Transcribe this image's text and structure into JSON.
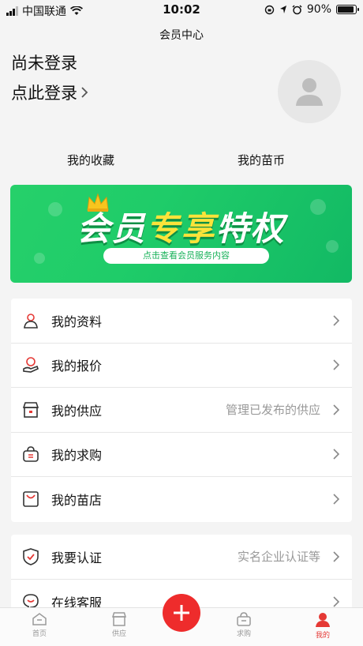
{
  "status_bar": {
    "carrier": "中国联通",
    "time": "10:02",
    "battery": "90%",
    "battery_level": 0.9
  },
  "nav": {
    "title": "会员中心"
  },
  "profile": {
    "name": "尚未登录",
    "login_prompt": "点此登录"
  },
  "quick_links": [
    {
      "label": "我的收藏"
    },
    {
      "label": "我的苗币"
    }
  ],
  "banner": {
    "title_part1": "会员",
    "title_highlight": "专享",
    "title_part2": "特权",
    "subtitle": "点击查看会员服务内容"
  },
  "menu_group1": [
    {
      "label": "我的资料",
      "hint": "",
      "icon": "profile-icon"
    },
    {
      "label": "我的报价",
      "hint": "",
      "icon": "quote-icon"
    },
    {
      "label": "我的供应",
      "hint": "管理已发布的供应",
      "icon": "store-icon"
    },
    {
      "label": "我的求购",
      "hint": "",
      "icon": "basket-icon"
    },
    {
      "label": "我的苗店",
      "hint": "",
      "icon": "shop-bag-icon"
    }
  ],
  "menu_group2": [
    {
      "label": "我要认证",
      "hint": "实名企业认证等",
      "icon": "shield-icon"
    },
    {
      "label": "在线客服",
      "hint": "",
      "icon": "chat-icon"
    }
  ],
  "tabbar": [
    {
      "label": "首页",
      "icon": "home-icon"
    },
    {
      "label": "供应",
      "icon": "store-icon"
    },
    {
      "label": "",
      "icon": "plus-icon"
    },
    {
      "label": "求购",
      "icon": "basket-icon"
    },
    {
      "label": "我的",
      "icon": "user-icon",
      "active": true
    }
  ],
  "colors": {
    "accent_red": "#ee2c2c",
    "banner_green": "#1fcc69",
    "banner_yellow": "#fbe33a"
  }
}
